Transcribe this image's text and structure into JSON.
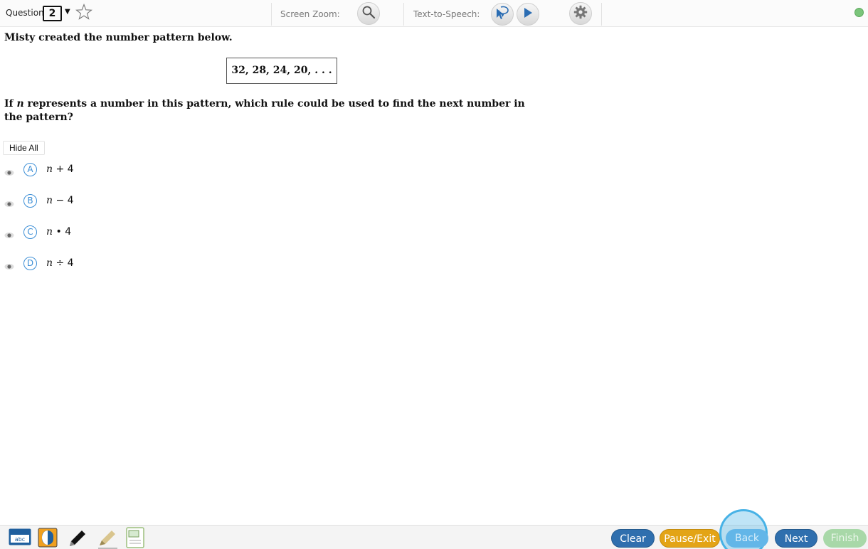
{
  "toolbar": {
    "question_label": "Question",
    "question_number": "2",
    "screen_zoom_label": "Screen Zoom:",
    "tts_label": "Text-to-Speech:",
    "status_color": "#7ac47a"
  },
  "content": {
    "intro": "Misty created the number pattern below.",
    "pattern": "32, 28, 24, 20, . . .",
    "question_prefix": "If ",
    "question_var": "n",
    "question_suffix": " represents a number in this pattern, which rule could be used to find the next number in the pattern?",
    "hide_all_label": "Hide All"
  },
  "choices": [
    {
      "letter": "A",
      "var": "n",
      "expr": " + 4"
    },
    {
      "letter": "B",
      "var": "n",
      "expr": " − 4"
    },
    {
      "letter": "C",
      "var": "n",
      "expr": " • 4"
    },
    {
      "letter": "D",
      "var": "n",
      "expr": " ÷ 4"
    }
  ],
  "bottom": {
    "abc_label": "abc",
    "clear_label": "Clear",
    "pause_label": "Pause/Exit",
    "back_label": "Back",
    "next_label": "Next",
    "finish_label": "Finish",
    "colors": {
      "clear": "#2f6fae",
      "pause": "#e3a416",
      "back": "#63b6e8",
      "next": "#2f6fae",
      "finish": "#a8d8a8"
    }
  }
}
